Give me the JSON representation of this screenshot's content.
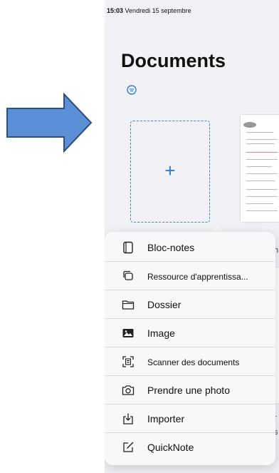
{
  "status_bar": {
    "time": "15:03",
    "date": "Vendredi 15 septembre"
  },
  "page": {
    "title": "Documents"
  },
  "new_document": {
    "plus": "+"
  },
  "background_fragments": {
    "frag1": "'C",
    "frag2": "h",
    "frag3": "r",
    "frag4": "s"
  },
  "menu": {
    "items": [
      {
        "label": "Bloc-notes",
        "icon": "notebook-icon"
      },
      {
        "label": "Ressource d'apprentissa...",
        "icon": "learning-resource-icon"
      },
      {
        "label": "Dossier",
        "icon": "folder-icon"
      },
      {
        "label": "Image",
        "icon": "image-icon"
      },
      {
        "label": "Scanner des documents",
        "icon": "scan-document-icon"
      },
      {
        "label": "Prendre une photo",
        "icon": "camera-icon"
      },
      {
        "label": "Importer",
        "icon": "import-icon"
      },
      {
        "label": "QuickNote",
        "icon": "quicknote-icon"
      }
    ]
  },
  "colors": {
    "accent": "#2a7de1",
    "arrow": "#5b8fd6"
  }
}
